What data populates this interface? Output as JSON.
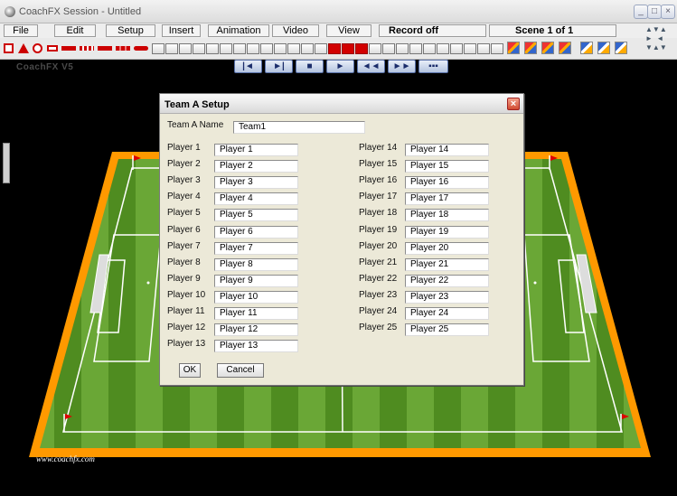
{
  "window": {
    "title": "CoachFX Session - Untitled"
  },
  "menubar": {
    "items": [
      "File",
      "Edit",
      "Setup",
      "Insert",
      "Animation",
      "Video",
      "View"
    ],
    "record_status": "Record off",
    "scene_status": "Scene  1 of 1"
  },
  "toolbar": {
    "tools": [
      "square-tool",
      "triangle-tool",
      "circle-tool",
      "rectangle-tool",
      "arrow-tool",
      "dribble-arrow-tool",
      "pass-arrow-tool",
      "run-arrow-tool",
      "curved-arrow-tool",
      "pen-tool",
      "text-tool",
      "grid-tool",
      "wall-tool",
      "ball-tool",
      "goal-tool",
      "zoom-in-tool",
      "zoom-out-tool",
      "field-tool",
      "target-tool",
      "link-tool",
      "pole-tool",
      "flag-tool",
      "cone-tool",
      "hurdle-tool",
      "arc-tool",
      "stick-tool",
      "bar-tool",
      "frame-tool",
      "ladder-tool",
      "mini-goal-tool",
      "corner-tool",
      "goal-frame-tool",
      "rotate-tool"
    ],
    "players_a": [
      "A1",
      "A2",
      "A3",
      "A4"
    ],
    "players_s": [
      "S1",
      "S2",
      "S3",
      "S4"
    ]
  },
  "transport": {
    "buttons": [
      "skip-start",
      "step-forward",
      "stop",
      "play",
      "rewind",
      "fast-forward",
      "players"
    ]
  },
  "workspace": {
    "watermark": "CoachFX V5",
    "site_url": "www.coachfx.com",
    "colors": {
      "border": "#ff9900",
      "grass_dark": "#4e8a1e",
      "grass_light": "#6aa836"
    }
  },
  "dialog": {
    "title": "Team A Setup",
    "team_name_label": "Team A Name",
    "team_name_value": "Team1",
    "players_left": [
      {
        "label": "Player 1",
        "value": "Player 1"
      },
      {
        "label": "Player 2",
        "value": "Player 2"
      },
      {
        "label": "Player 3",
        "value": "Player 3"
      },
      {
        "label": "Player 4",
        "value": "Player 4"
      },
      {
        "label": "Player 5",
        "value": "Player 5"
      },
      {
        "label": "Player 6",
        "value": "Player 6"
      },
      {
        "label": "Player 7",
        "value": "Player 7"
      },
      {
        "label": "Player 8",
        "value": "Player 8"
      },
      {
        "label": "Player 9",
        "value": "Player 9"
      },
      {
        "label": "Player 10",
        "value": "Player 10"
      },
      {
        "label": "Player 11",
        "value": "Player 11"
      },
      {
        "label": "Player 12",
        "value": "Player 12"
      },
      {
        "label": "Player 13",
        "value": "Player 13"
      }
    ],
    "players_right": [
      {
        "label": "Player 14",
        "value": "Player 14"
      },
      {
        "label": "Player 15",
        "value": "Player 15"
      },
      {
        "label": "Player 16",
        "value": "Player 16"
      },
      {
        "label": "Player 17",
        "value": "Player 17"
      },
      {
        "label": "Player 18",
        "value": "Player 18"
      },
      {
        "label": "Player 19",
        "value": "Player 19"
      },
      {
        "label": "Player 20",
        "value": "Player 20"
      },
      {
        "label": "Player 21",
        "value": "Player 21"
      },
      {
        "label": "Player 22",
        "value": "Player 22"
      },
      {
        "label": "Player 23",
        "value": "Player 23"
      },
      {
        "label": "Player 24",
        "value": "Player 24"
      },
      {
        "label": "Player 25",
        "value": "Player 25"
      }
    ],
    "ok_label": "OK",
    "cancel_label": "Cancel"
  }
}
